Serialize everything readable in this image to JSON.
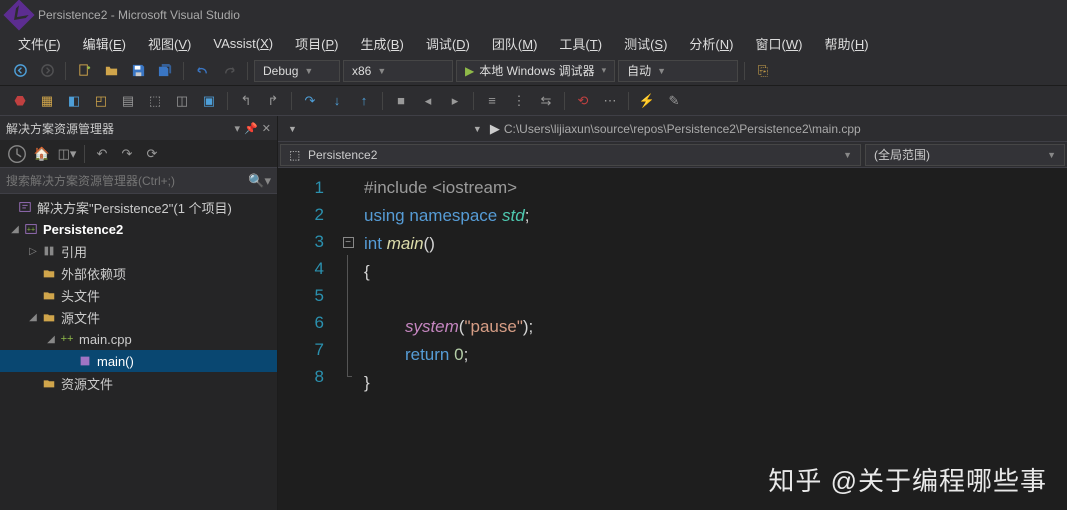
{
  "title": "Persistence2 - Microsoft Visual Studio",
  "menus": [
    {
      "label": "文件",
      "key": "F"
    },
    {
      "label": "编辑",
      "key": "E"
    },
    {
      "label": "视图",
      "key": "V"
    },
    {
      "label": "VAssist",
      "key": "X"
    },
    {
      "label": "项目",
      "key": "P"
    },
    {
      "label": "生成",
      "key": "B"
    },
    {
      "label": "调试",
      "key": "D"
    },
    {
      "label": "团队",
      "key": "M"
    },
    {
      "label": "工具",
      "key": "T"
    },
    {
      "label": "测试",
      "key": "S"
    },
    {
      "label": "分析",
      "key": "N"
    },
    {
      "label": "窗口",
      "key": "W"
    },
    {
      "label": "帮助",
      "key": "H"
    }
  ],
  "toolbar": {
    "config": "Debug",
    "platform": "x86",
    "start": "本地 Windows 调试器",
    "auto": "自动"
  },
  "solution_panel": {
    "title": "解决方案资源管理器",
    "search_placeholder": "搜索解决方案资源管理器(Ctrl+;)"
  },
  "tree": {
    "sln": "解决方案\"Persistence2\"(1 个项目)",
    "proj": "Persistence2",
    "refs": "引用",
    "ext": "外部依赖项",
    "hdr": "头文件",
    "src": "源文件",
    "file": "main.cpp",
    "func": "main()",
    "res": "资源文件"
  },
  "editor": {
    "path": "C:\\Users\\lijiaxun\\source\\repos\\Persistence2\\Persistence2\\main.cpp",
    "ctx_proj": "Persistence2",
    "ctx_scope": "(全局范围)"
  },
  "code": {
    "lines": [
      "1",
      "2",
      "3",
      "4",
      "5",
      "6",
      "7",
      "8"
    ],
    "l1a": "#include ",
    "l1b": "<iostream>",
    "l2a": "using ",
    "l2b": "namespace ",
    "l2c": "std",
    "l2d": ";",
    "l3a": "int ",
    "l3b": "main",
    "l3c": "()",
    "l4": "{",
    "l6a": "system",
    "l6b": "(",
    "l6c": "\"pause\"",
    "l6d": ");",
    "l7a": "return ",
    "l7b": "0",
    "l7c": ";",
    "l8": "}"
  },
  "watermark": "知乎 @关于编程哪些事"
}
